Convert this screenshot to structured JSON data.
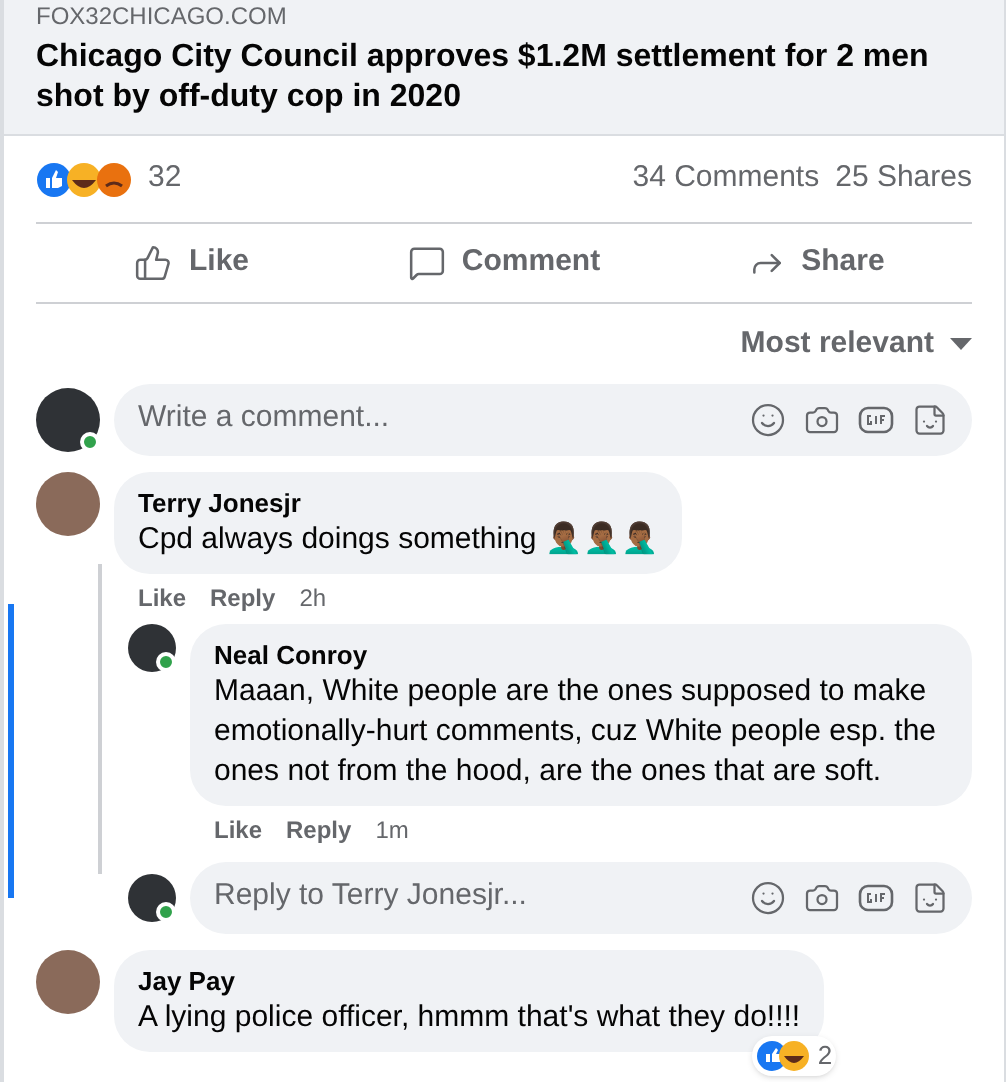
{
  "link_preview": {
    "source": "FOX32CHICAGO.COM",
    "headline": "Chicago City Council approves $1.2M settlement for 2 men shot by off-duty cop in 2020"
  },
  "reactions": {
    "count": "32"
  },
  "stats": {
    "comments": "34 Comments",
    "shares": "25 Shares"
  },
  "actions": [
    {
      "kind": "like",
      "label": "Like"
    },
    {
      "kind": "comment",
      "label": "Comment"
    },
    {
      "kind": "share",
      "label": "Share"
    }
  ],
  "sort": {
    "label": "Most relevant"
  },
  "composer": {
    "placeholder": "Write a comment...",
    "online": true
  },
  "comments": [
    {
      "author": "Terry Jonesjr",
      "text": "Cpd always doings something 🤦🏾‍♂️🤦🏾‍♂️🤦🏾‍♂️",
      "like": "Like",
      "reply": "Reply",
      "time": "2h",
      "replies": [
        {
          "author": "Neal Conroy",
          "text": "Maaan, White people are the ones supposed to make emotionally-hurt comments, cuz White people esp. the ones not from the hood, are the ones that are soft.",
          "like": "Like",
          "reply": "Reply",
          "time": "1m",
          "online": true
        }
      ],
      "reply_composer": {
        "placeholder": "Reply to Terry Jonesjr...",
        "online": true
      }
    },
    {
      "author": "Jay Pay",
      "text": "A lying police officer, hmmm that's what they do!!!!",
      "reaction_count": "2"
    }
  ]
}
